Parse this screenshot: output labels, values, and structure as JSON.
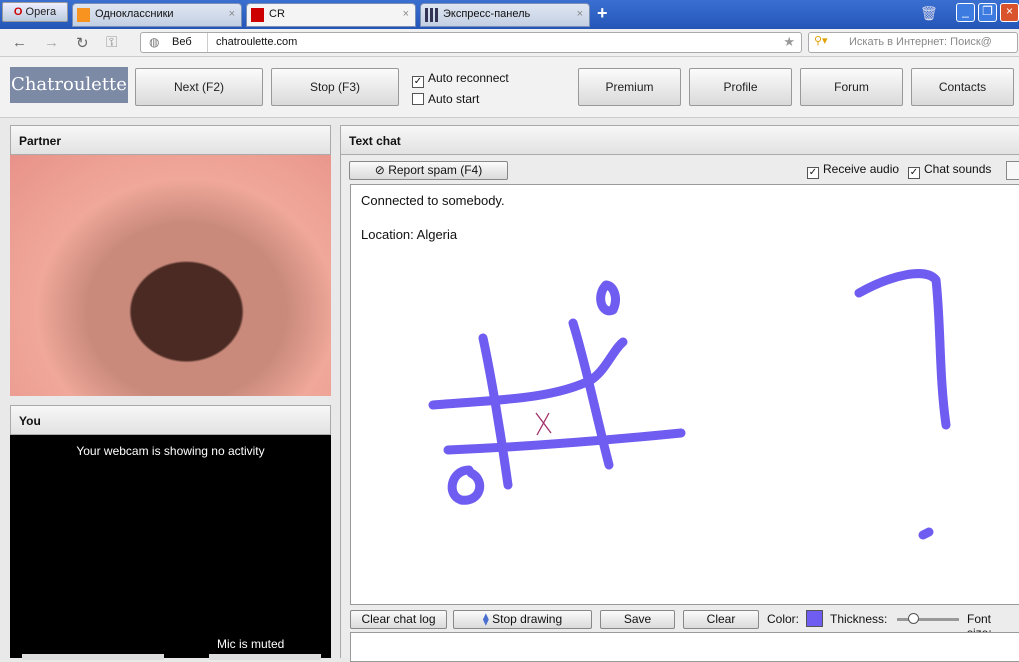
{
  "browser": {
    "menu_label": "Opera",
    "tabs": [
      {
        "label": "Одноклассники"
      },
      {
        "label": "CR"
      },
      {
        "label": "Экспресс-панель"
      }
    ],
    "address_prefix": "Веб",
    "url": "chatroulette.com",
    "search_placeholder": "Искать в Интернет: Поиск@"
  },
  "header": {
    "logo": "Chatroulette",
    "next": "Next (F2)",
    "stop": "Stop (F3)",
    "auto_reconnect": "Auto reconnect",
    "auto_start": "Auto start",
    "premium": "Premium",
    "profile": "Profile",
    "forum": "Forum",
    "contacts": "Contacts"
  },
  "partner": {
    "title": "Partner"
  },
  "you": {
    "title": "You",
    "no_activity": "Your webcam is showing no activity",
    "mic_muted": "Mic is muted"
  },
  "chat": {
    "title": "Text chat",
    "report_spam": "Report spam (F4)",
    "receive_audio": "Receive audio",
    "chat_sounds": "Chat sounds",
    "messages": [
      "Connected to somebody.",
      "Location: Algeria"
    ]
  },
  "toolbar": {
    "clear_log": "Clear chat log",
    "stop_drawing": "Stop drawing",
    "save": "Save",
    "clear": "Clear",
    "color_label": "Color:",
    "thickness_label": "Thickness:",
    "font_size_label": "Font size:",
    "draw_color": "#6f5cf0",
    "thickness": 0.25
  }
}
